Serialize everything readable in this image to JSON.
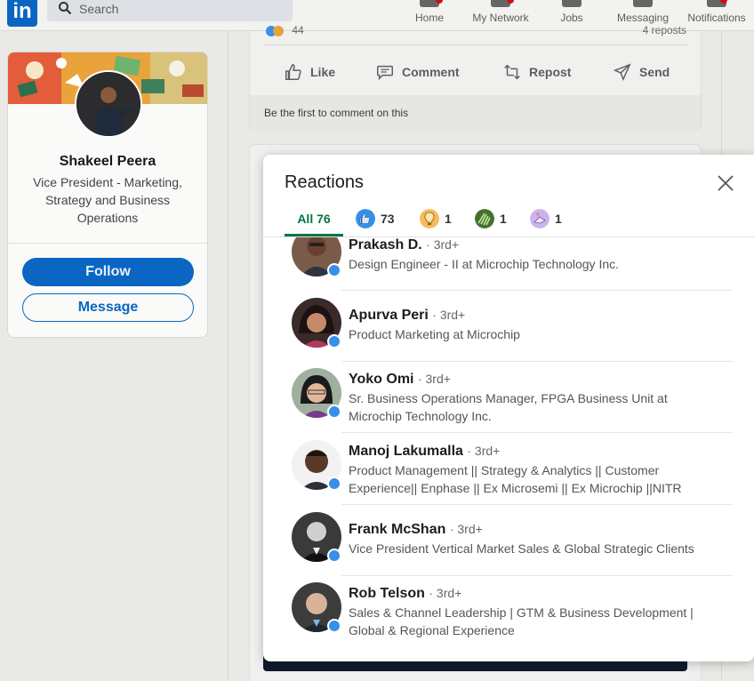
{
  "nav": {
    "logo": "in",
    "search_placeholder": "Search",
    "items": [
      {
        "label": "Home"
      },
      {
        "label": "My Network"
      },
      {
        "label": "Jobs"
      },
      {
        "label": "Messaging"
      },
      {
        "label": "Notifications"
      }
    ]
  },
  "profile": {
    "name": "Shakeel Peera",
    "title": "Vice President - Marketing, Strategy and Business Operations",
    "follow_label": "Follow",
    "message_label": "Message"
  },
  "post": {
    "reaction_count": "44",
    "reposts": "4 reposts",
    "actions": [
      {
        "label": "Like"
      },
      {
        "label": "Comment"
      },
      {
        "label": "Repost"
      },
      {
        "label": "Send"
      }
    ],
    "comment_prompt": "Be the first to comment on this"
  },
  "modal": {
    "title": "Reactions",
    "tabs": [
      {
        "label": "All 76",
        "active": true
      },
      {
        "label": "73",
        "icon": "like-icon"
      },
      {
        "label": "1",
        "icon": "insightful-icon"
      },
      {
        "label": "1",
        "icon": "support-icon"
      },
      {
        "label": "1",
        "icon": "celebrate-icon"
      }
    ],
    "reactors": [
      {
        "name": "Prakash D.",
        "degree": "· 3rd+",
        "headline": "Design Engineer - II at Microchip Technology Inc."
      },
      {
        "name": "Apurva Peri",
        "degree": "· 3rd+",
        "headline": "Product Marketing at Microchip"
      },
      {
        "name": "Yoko Omi",
        "degree": "· 3rd+",
        "headline": "Sr. Business Operations Manager, FPGA Business Unit at Microchip Technology Inc."
      },
      {
        "name": "Manoj Lakumalla",
        "degree": "· 3rd+",
        "headline": "Product Management || Strategy & Analytics || Customer Experience|| Enphase || Ex Microsemi || Ex Microchip ||NITR"
      },
      {
        "name": "Frank McShan",
        "degree": "· 3rd+",
        "headline": "Vice President Vertical Market Sales & Global Strategic Clients"
      },
      {
        "name": "Rob Telson",
        "degree": "· 3rd+",
        "headline": "Sales & Channel Leadership | GTM & Business Development | Global & Regional Experience"
      }
    ]
  },
  "colors": {
    "brand": "#0a66c2",
    "active_tab": "#057642",
    "like_badge": "#378fe9"
  }
}
